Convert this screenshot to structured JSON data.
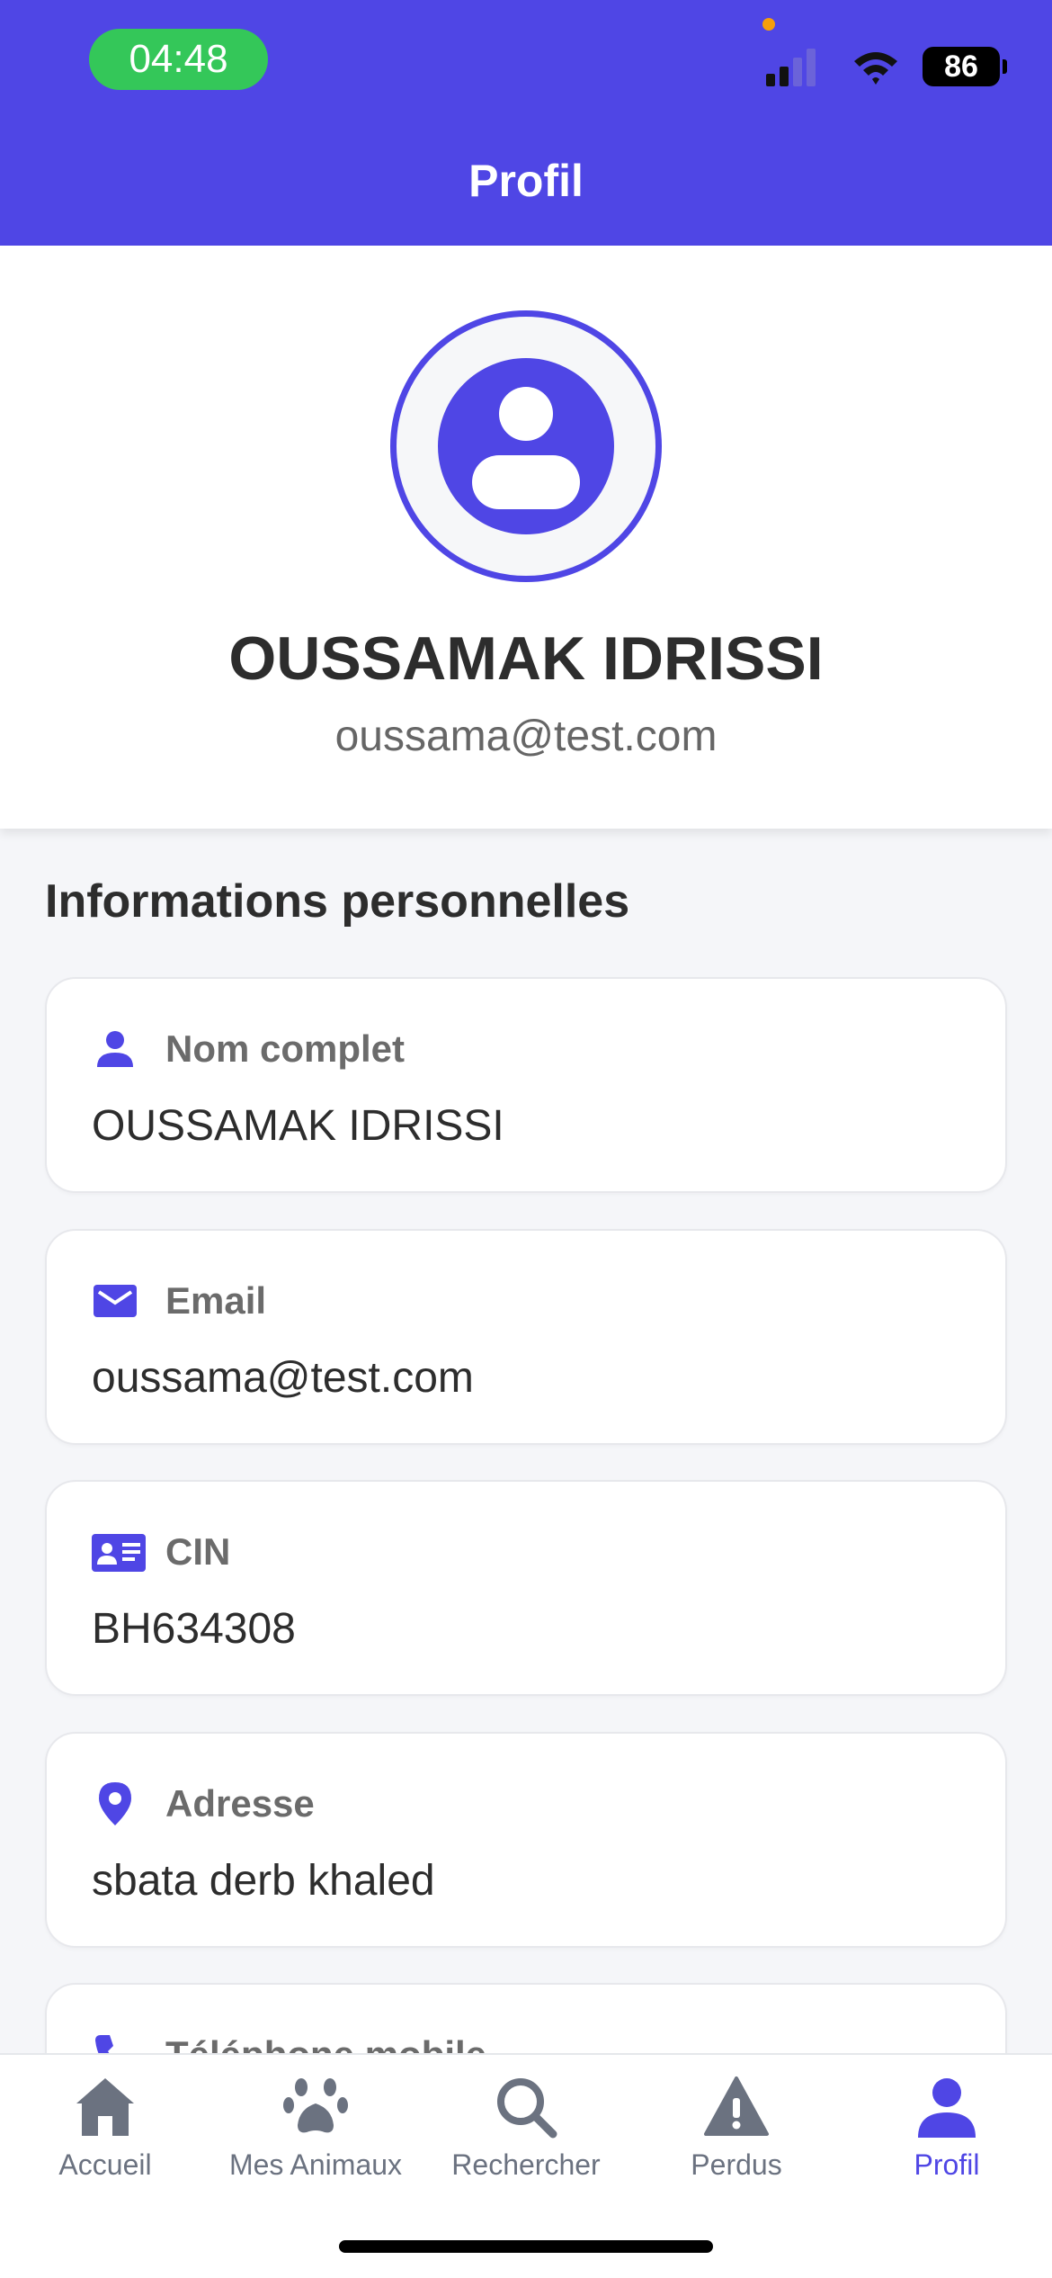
{
  "status_bar": {
    "time": "04:48",
    "battery": "86"
  },
  "header": {
    "title": "Profil"
  },
  "profile": {
    "name": "OUSSAMAK IDRISSI",
    "email": "oussama@test.com"
  },
  "section_title": "Informations personnelles",
  "info_items": [
    {
      "icon": "user-icon",
      "label": "Nom complet",
      "value": "OUSSAMAK IDRISSI"
    },
    {
      "icon": "mail-icon",
      "label": "Email",
      "value": "oussama@test.com"
    },
    {
      "icon": "id-card-icon",
      "label": "CIN",
      "value": "BH634308"
    },
    {
      "icon": "location-pin-icon",
      "label": "Adresse",
      "value": "sbata derb khaled"
    },
    {
      "icon": "phone-icon",
      "label": "Téléphone mobile",
      "value": ""
    }
  ],
  "nav": [
    {
      "icon": "home-icon",
      "label": "Accueil"
    },
    {
      "icon": "paw-icon",
      "label": "Mes Animaux"
    },
    {
      "icon": "search-icon",
      "label": "Rechercher"
    },
    {
      "icon": "warning-icon",
      "label": "Perdus"
    },
    {
      "icon": "profile-icon",
      "label": "Profil",
      "active": true
    }
  ],
  "colors": {
    "primary": "#4f46e5",
    "background": "#f5f6f9",
    "time_pill": "#34c759",
    "inactive": "#6b7280"
  }
}
